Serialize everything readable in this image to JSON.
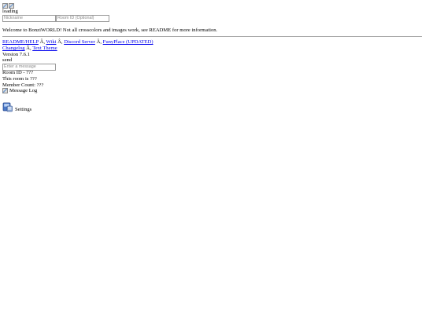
{
  "top": {
    "loading_text": "loading",
    "nickname_placeholder": "Nickname",
    "room_placeholder": "Room ID (Optional)"
  },
  "welcome": "Welcome to BonziWORLD! Not all crosscolors and images work, see README for more information.",
  "links": {
    "row1": [
      "README/HELP",
      "Wiki",
      "Discord Server",
      "FunyPlace (UPDATED)"
    ],
    "row2": [
      "Changelog",
      "Text Theme"
    ],
    "separator": "Â,"
  },
  "version": "Version 7.6.1",
  "send_label": "send",
  "message_placeholder": "Enter a message",
  "room_info": {
    "room_id": "Room ID - ???",
    "room_is": "This room is ???",
    "member_count": "Member Count: ???"
  },
  "message_log_label": "Message Log",
  "settings_label": "Settings",
  "icons": {
    "broken_image": "broken-image-icon",
    "settings": "settings-icon"
  },
  "colors": {
    "link": "#0000ee",
    "border": "#9a9a9a"
  }
}
